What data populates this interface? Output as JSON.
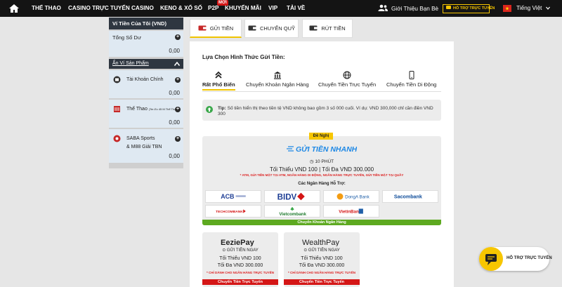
{
  "nav": {
    "items": [
      "THỂ THAO",
      "CASINO TRỰC TUYẾN",
      "CASINO",
      "KENO & XỔ SỐ",
      "P2P",
      "KHUYẾN MÃI",
      "VIP",
      "TẢI VỀ"
    ],
    "new_badge": "MỚI",
    "referral": "Giới Thiệu Bạn Bè",
    "support": "HỖ TRỢ TRỰC TUYẾN",
    "language": "Tiếng Việt"
  },
  "sidebar": {
    "title": "Ví Tiền Của Tôi (VND)",
    "total_label": "Tổng Số Dư",
    "total_value": "0,00",
    "hide_label": "Ẩn Ví Sản Phẩm",
    "main_label": "Tài Khoản Chính",
    "main_value": "0,00",
    "sports_label": "Thể Thao",
    "sports_note": "(Ter-Ec 45 M Thể Thao)",
    "sports_value": "0,00",
    "saba_label_1": "SABA Sports",
    "saba_label_2": "& M88 Giải TBN",
    "saba_value": "0,00"
  },
  "tabs": [
    "GỬI TIỀN",
    "CHUYỂN QUỸ",
    "RÚT TIỀN"
  ],
  "main": {
    "method_title": "Lựa Chọn Hình Thức Gửi Tiền:",
    "method_tabs": [
      "Rất Phổ Biến",
      "Chuyển Khoản Ngân Hàng",
      "Chuyển Tiền Trực Tuyến",
      "Chuyển Tiền Di Động"
    ],
    "tip_label": "Tip:",
    "tip_text": "Số tiền hiển thị theo tiền tệ VND không bao gồm 3 số 000 cuối. Ví dụ: VND 300,000 chỉ cần điền VND 300"
  },
  "card": {
    "recommend": "Đề Nghị",
    "logo_text": "GỬI TIỀN NHANH",
    "time": "10 PHÚT",
    "limits": "Tối Thiểu VND 100 | Tối Đa VND 300.000",
    "note": "* ATM, GỬI TIỀN MẶT TẠI ATM, NGÂN HÀNG DI ĐỘNG, NGÂN HÀNG TRỰC TUYẾN, GỬI TIỀN MẶT TẠI QUẦY",
    "banks_title": "Các Ngân Hàng Hỗ Trợ:",
    "banks": [
      "ACB",
      "BIDV",
      "DongA Bank",
      "Sacombank",
      "TECHCOMBANK",
      "Vietcombank",
      "VietinBank"
    ],
    "foot": "Chuyển Khoản Ngân Hàng"
  },
  "pay_cards": [
    {
      "logo": "EeziePay",
      "sub": "GỬI TIỀN NGAY",
      "min": "Tối Thiểu VND 100",
      "max": "Tối Đa VND 300.000",
      "note": "* CHỈ DÀNH CHO NGÂN HÀNG TRỰC TUYẾN",
      "foot": "Chuyển Tiền Trực Tuyến"
    },
    {
      "logo": "WealthPay",
      "sub": "GỬI TIỀN NGAY",
      "min": "Tối Thiểu VND 100",
      "max": "Tối Đa VND 300.000",
      "note": "* CHỈ DÀNH CHO NGÂN HÀNG TRỰC TUYẾN",
      "foot": "Chuyển Tiền Trực Tuyến"
    }
  ],
  "float_support": "HỖ TRỢ TRỰC TUYẾN",
  "colors": {
    "accent": "#f7c600",
    "nav_bg": "#141414",
    "green": "#5da920",
    "red": "#d41616"
  }
}
